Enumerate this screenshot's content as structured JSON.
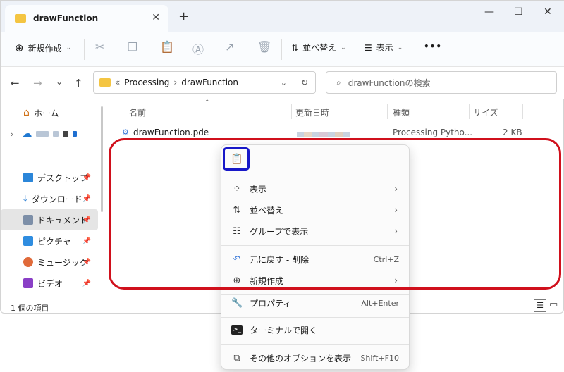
{
  "window": {
    "tab_title": "drawFunction"
  },
  "toolbar": {
    "new_label": "新規作成",
    "sort_label": "並べ替え",
    "view_label": "表示",
    "more": "•••"
  },
  "address": {
    "prefix": "«",
    "crumb1": "Processing",
    "separator": "›",
    "crumb2": "drawFunction"
  },
  "search": {
    "placeholder": "drawFunctionの検索"
  },
  "sidebar": {
    "items": [
      {
        "label": "ホーム"
      },
      {
        "label": "デスクトップ"
      },
      {
        "label": "ダウンロード"
      },
      {
        "label": "ドキュメント"
      },
      {
        "label": "ピクチャ"
      },
      {
        "label": "ミュージック"
      },
      {
        "label": "ビデオ"
      }
    ]
  },
  "columns": {
    "name": "名前",
    "date": "更新日時",
    "type": "種類",
    "size": "サイズ"
  },
  "files": [
    {
      "name": "drawFunction.pde",
      "type": "Processing Pytho...",
      "size": "2 KB"
    }
  ],
  "status": {
    "count": "1 個の項目"
  },
  "context_menu": {
    "items": [
      {
        "label": "表示"
      },
      {
        "label": "並べ替え"
      },
      {
        "label": "グループで表示"
      },
      {
        "label": "元に戻す - 削除",
        "shortcut": "Ctrl+Z"
      },
      {
        "label": "新規作成"
      },
      {
        "label": "プロパティ",
        "shortcut": "Alt+Enter"
      },
      {
        "label": "ターミナルで開く"
      },
      {
        "label": "その他のオプションを表示",
        "shortcut": "Shift+F10"
      }
    ]
  },
  "colors": {
    "highlight_blue": "#1818c8",
    "highlight_red": "#d0101c",
    "folder": "#f4c542"
  }
}
